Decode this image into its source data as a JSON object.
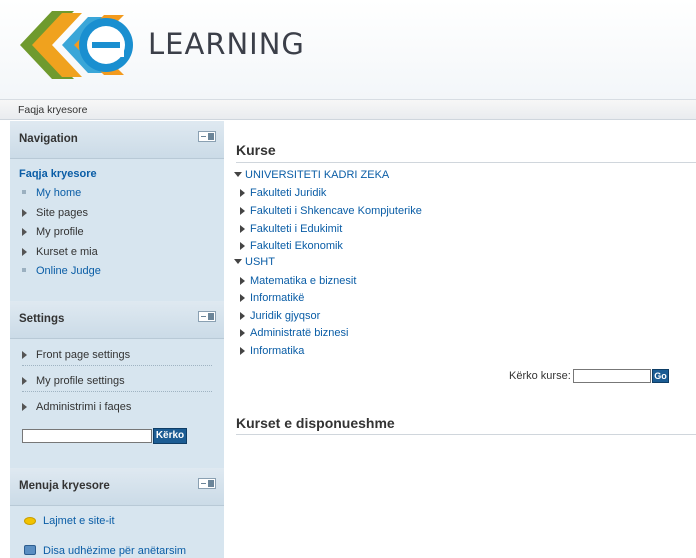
{
  "brand": {
    "logo_text": "LEARNING",
    "logo_letter": "e"
  },
  "breadcrumb": {
    "home": "Faqja kryesore"
  },
  "navigation": {
    "title": "Navigation",
    "home_label": "Faqja kryesore",
    "items": [
      {
        "label": "My home",
        "marker": "square"
      },
      {
        "label": "Site pages",
        "marker": "arrow"
      },
      {
        "label": "My profile",
        "marker": "arrow"
      },
      {
        "label": "Kurset e mia",
        "marker": "arrow"
      },
      {
        "label": "Online Judge",
        "marker": "square"
      }
    ]
  },
  "settings": {
    "title": "Settings",
    "items": [
      "Front page settings",
      "My profile settings",
      "Administrimi i faqes"
    ],
    "search_button": "Kërko"
  },
  "main_menu": {
    "title": "Menuja kryesore",
    "items": [
      "Lajmet e site-it",
      "Disa udhëzime për anëtarsim"
    ]
  },
  "courses": {
    "title": "Kurse",
    "categories": [
      {
        "name": "UNIVERSITETI KADRI ZEKA",
        "expanded": true,
        "children": [
          "Fakulteti Juridik",
          "Fakulteti i Shkencave Kompjuterike",
          "Fakulteti i Edukimit",
          "Fakulteti Ekonomik"
        ]
      },
      {
        "name": "USHT",
        "expanded": true,
        "children": [
          "Matematika e biznesit",
          "Informatikë",
          "Juridik gjyqsor",
          "Administratë biznesi",
          "Informatika"
        ]
      }
    ],
    "search_label": "Kërko kurse:",
    "search_button": "Go"
  },
  "available_courses": {
    "title": "Kurset e disponueshme"
  },
  "colors": {
    "accent_blue": "#0a5da6",
    "sidebar_bg": "#d7e5ef",
    "button_blue": "#1b5c93"
  }
}
